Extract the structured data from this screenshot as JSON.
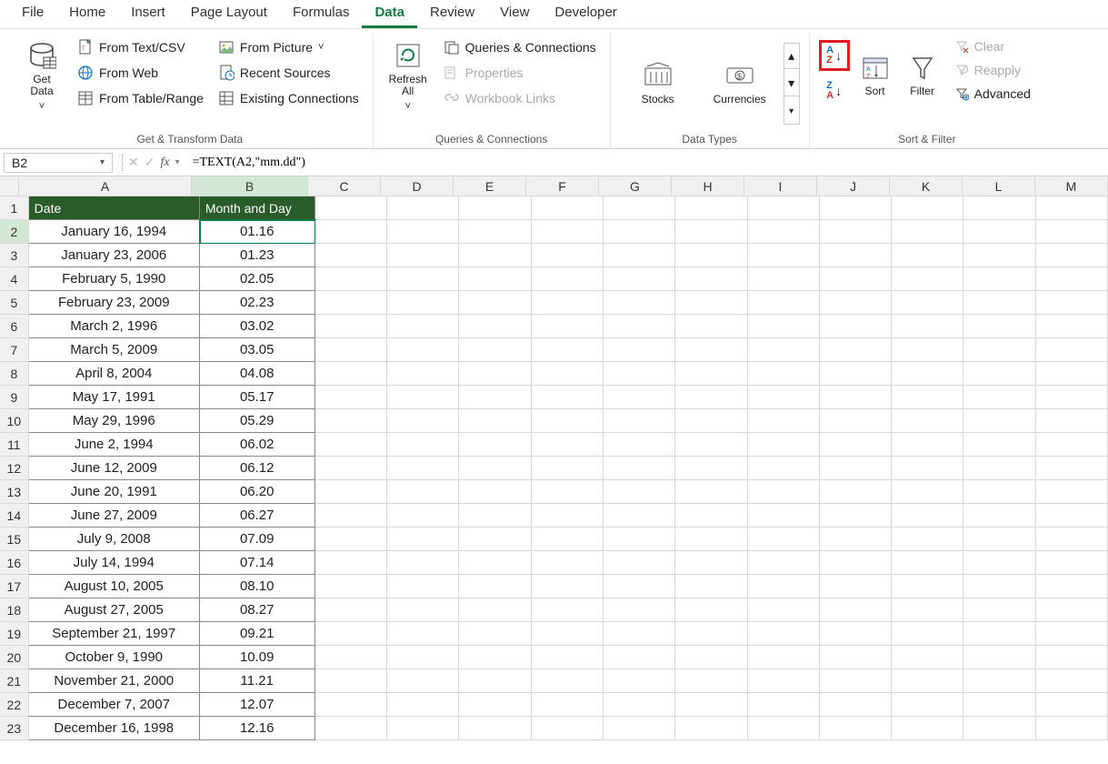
{
  "tabs": [
    "File",
    "Home",
    "Insert",
    "Page Layout",
    "Formulas",
    "Data",
    "Review",
    "View",
    "Developer"
  ],
  "active_tab_index": 5,
  "ribbon": {
    "get_transform": {
      "label": "Get & Transform Data",
      "get_data": "Get\nData",
      "from_text": "From Text/CSV",
      "from_web": "From Web",
      "from_table": "From Table/Range",
      "from_picture": "From Picture",
      "recent_sources": "Recent Sources",
      "existing_conn": "Existing Connections"
    },
    "queries": {
      "label": "Queries & Connections",
      "refresh": "Refresh\nAll",
      "queries_conn": "Queries & Connections",
      "properties": "Properties",
      "workbook_links": "Workbook Links"
    },
    "data_types": {
      "label": "Data Types",
      "stocks": "Stocks",
      "currencies": "Currencies"
    },
    "sort_filter": {
      "label": "Sort & Filter",
      "sort": "Sort",
      "filter": "Filter",
      "clear": "Clear",
      "reapply": "Reapply",
      "advanced": "Advanced"
    }
  },
  "name_box": "B2",
  "formula": "=TEXT(A2,\"mm.dd\")",
  "columns": [
    "A",
    "B",
    "C",
    "D",
    "E",
    "F",
    "G",
    "H",
    "I",
    "J",
    "K",
    "L",
    "M"
  ],
  "headers": {
    "A": "Date",
    "B": "Month and Day"
  },
  "rows": [
    {
      "n": 1
    },
    {
      "n": 2,
      "A": "January 16, 1994",
      "B": "01.16"
    },
    {
      "n": 3,
      "A": "January 23, 2006",
      "B": "01.23"
    },
    {
      "n": 4,
      "A": "February 5, 1990",
      "B": "02.05"
    },
    {
      "n": 5,
      "A": "February 23, 2009",
      "B": "02.23"
    },
    {
      "n": 6,
      "A": "March 2, 1996",
      "B": "03.02"
    },
    {
      "n": 7,
      "A": "March 5, 2009",
      "B": "03.05"
    },
    {
      "n": 8,
      "A": "April 8, 2004",
      "B": "04.08"
    },
    {
      "n": 9,
      "A": "May 17, 1991",
      "B": "05.17"
    },
    {
      "n": 10,
      "A": "May 29, 1996",
      "B": "05.29"
    },
    {
      "n": 11,
      "A": "June 2, 1994",
      "B": "06.02"
    },
    {
      "n": 12,
      "A": "June 12, 2009",
      "B": "06.12"
    },
    {
      "n": 13,
      "A": "June 20, 1991",
      "B": "06.20"
    },
    {
      "n": 14,
      "A": "June 27, 2009",
      "B": "06.27"
    },
    {
      "n": 15,
      "A": "July 9, 2008",
      "B": "07.09"
    },
    {
      "n": 16,
      "A": "July 14, 1994",
      "B": "07.14"
    },
    {
      "n": 17,
      "A": "August 10, 2005",
      "B": "08.10"
    },
    {
      "n": 18,
      "A": "August 27, 2005",
      "B": "08.27"
    },
    {
      "n": 19,
      "A": "September 21, 1997",
      "B": "09.21"
    },
    {
      "n": 20,
      "A": "October 9, 1990",
      "B": "10.09"
    },
    {
      "n": 21,
      "A": "November 21, 2000",
      "B": "11.21"
    },
    {
      "n": 22,
      "A": "December 7, 2007",
      "B": "12.07"
    },
    {
      "n": 23,
      "A": "December 16, 1998",
      "B": "12.16"
    }
  ],
  "selected_cell": "B2"
}
